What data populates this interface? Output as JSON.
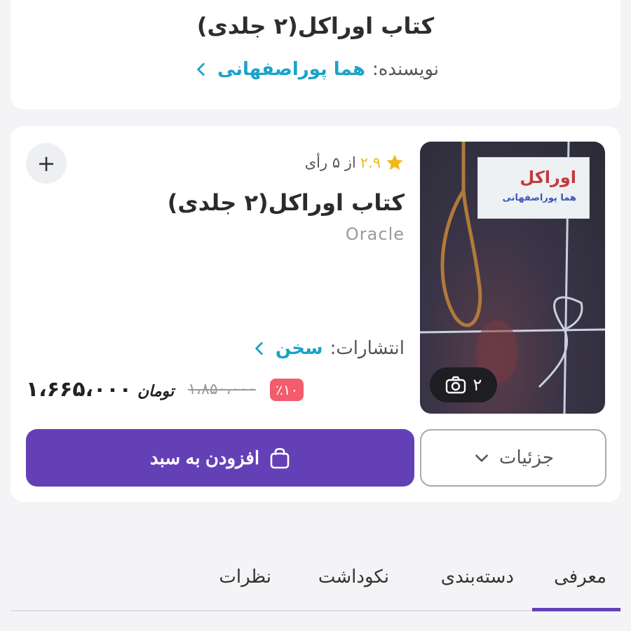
{
  "header": {
    "title": "کتاب اوراکل(۲ جلدی)",
    "author_label": "نویسنده:",
    "author_name": "هما پوراصفهانی"
  },
  "product": {
    "cover": {
      "title": "اوراکل",
      "author": "هما پوراصفهانی",
      "image_count": "۲",
      "icon": "camera-icon"
    },
    "rating": {
      "value": "۲.۹",
      "text": "از ۵ رأی",
      "icon": "star-icon"
    },
    "title": "کتاب اوراکل(۲ جلدی)",
    "subtitle": "Oracle",
    "publisher_label": "انتشارات:",
    "publisher_name": "سخن",
    "price": {
      "final": "۱،۶۶۵،۰۰۰",
      "currency": "تومان",
      "old": "۱،۸۵۰،۰۰۰",
      "discount": "٪۱۰"
    },
    "add_to_cart_label": "افزودن به سبد",
    "details_label": "جزئیات",
    "add_icon": "plus-icon"
  },
  "tabs": [
    {
      "label": "معرفی",
      "active": true
    },
    {
      "label": "دسته‌بندی",
      "active": false
    },
    {
      "label": "نکوداشت",
      "active": false
    },
    {
      "label": "نظرات",
      "active": false
    }
  ],
  "colors": {
    "accent": "#6440b7",
    "link": "#1aa3c9",
    "discount": "#f25c6b",
    "star": "#f1b91c"
  }
}
